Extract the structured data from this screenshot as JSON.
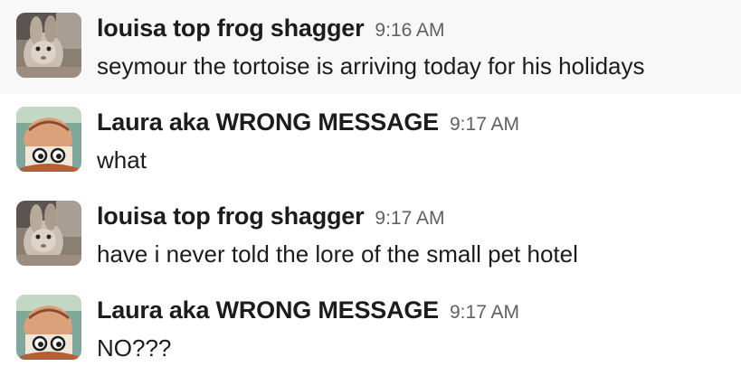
{
  "messages": [
    {
      "author": "louisa top frog shagger",
      "time": "9:16 AM",
      "text": "seymour the tortoise is arriving today for his holidays",
      "avatar": "rabbit-avatar",
      "hovered": true
    },
    {
      "author": "Laura aka WRONG MESSAGE",
      "time": "9:17 AM",
      "text": "what",
      "avatar": "cartoon-avatar",
      "hovered": false
    },
    {
      "author": "louisa top frog shagger",
      "time": "9:17 AM",
      "text": "have i never told the lore of the small pet hotel",
      "avatar": "rabbit-avatar",
      "hovered": false
    },
    {
      "author": "Laura aka WRONG MESSAGE",
      "time": "9:17 AM",
      "text": "NO???",
      "avatar": "cartoon-avatar",
      "hovered": false
    }
  ],
  "colors": {
    "text": "#1d1c1d",
    "timestamp": "#616061",
    "hover_background": "#f8f8f8"
  }
}
